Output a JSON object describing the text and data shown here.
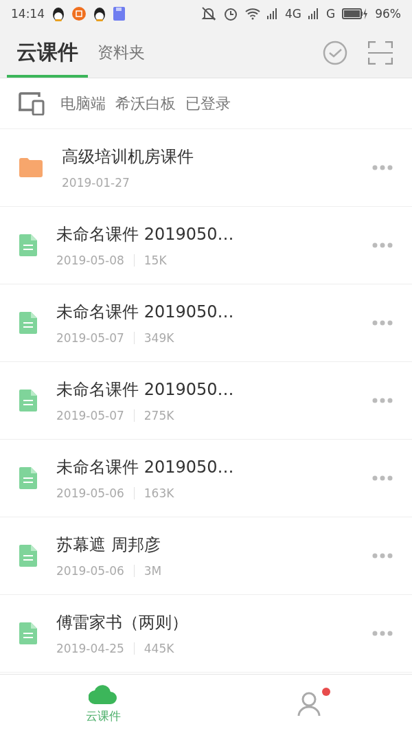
{
  "status_bar": {
    "time": "14:14",
    "network_1": "4G",
    "network_2": "G",
    "battery": "96%"
  },
  "tabs": [
    {
      "label": "云课件",
      "selected": true
    },
    {
      "label": "资料夹",
      "selected": false
    }
  ],
  "login_bar": {
    "text": "电脑端  希沃白板  已登录"
  },
  "items": [
    {
      "kind": "folder",
      "title": "高级培训机房课件",
      "date": "2019-01-27"
    },
    {
      "kind": "file",
      "title": "未命名课件 2019050…",
      "date": "2019-05-08",
      "size": "15K"
    },
    {
      "kind": "file",
      "title": "未命名课件 2019050…",
      "date": "2019-05-07",
      "size": "349K"
    },
    {
      "kind": "file",
      "title": "未命名课件 2019050…",
      "date": "2019-05-07",
      "size": "275K"
    },
    {
      "kind": "file",
      "title": "未命名课件 2019050…",
      "date": "2019-05-06",
      "size": "163K"
    },
    {
      "kind": "file",
      "title": "苏幕遮 周邦彦",
      "date": "2019-05-06",
      "size": "3M"
    },
    {
      "kind": "file",
      "title": "傅雷家书（两则）",
      "date": "2019-04-25",
      "size": "445K"
    }
  ],
  "bottom_nav": [
    {
      "kind": "cloud",
      "label": "云课件",
      "selected": true
    },
    {
      "kind": "profile",
      "selected": false,
      "badge": true
    }
  ]
}
